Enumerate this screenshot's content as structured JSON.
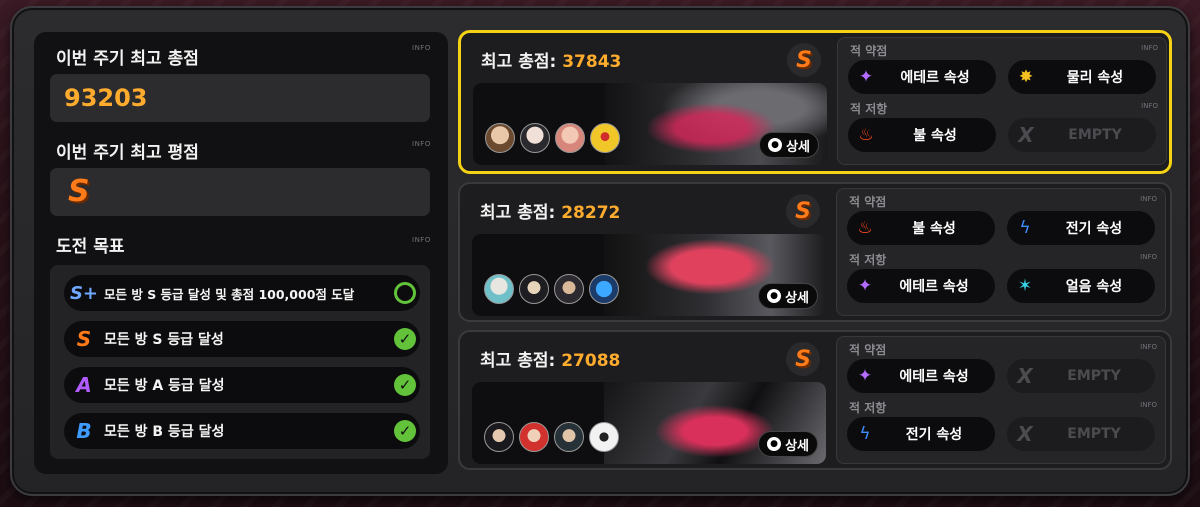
{
  "left_panel": {
    "cycle_best_score_title": "이번 주기 최고 총점",
    "cycle_best_score": "93203",
    "cycle_best_grade_title": "이번 주기 최고 평점",
    "cycle_best_grade": "S",
    "goals_title": "도전 목표",
    "info": "INFO",
    "goals": [
      {
        "badge": "S+",
        "text": "모든 방 S 등급 달성 및 총점 100,000점 도달",
        "done": false
      },
      {
        "badge": "S",
        "text": "모든 방 S 등급 달성",
        "done": true
      },
      {
        "badge": "A",
        "text": "모든 방 A 등급 달성",
        "done": true
      },
      {
        "badge": "B",
        "text": "모든 방 B 등급 달성",
        "done": true
      }
    ]
  },
  "labels": {
    "best_score": "최고 총점: ",
    "weak": "적 약점",
    "resist": "적 저항",
    "detail": "상세",
    "info": "INFO"
  },
  "rooms": [
    {
      "score": "37843",
      "rank": "S",
      "selected": true,
      "weak": [
        {
          "name": "에테르 속성",
          "icon": "ether-icon"
        },
        {
          "name": "물리 속성",
          "icon": "physical-icon"
        }
      ],
      "resist": [
        {
          "name": "불 속성",
          "icon": "fire-icon"
        },
        {
          "name": "EMPTY",
          "icon": "empty-icon"
        }
      ]
    },
    {
      "score": "28272",
      "rank": "S",
      "selected": false,
      "weak": [
        {
          "name": "불 속성",
          "icon": "fire-icon"
        },
        {
          "name": "전기 속성",
          "icon": "electric-icon"
        }
      ],
      "resist": [
        {
          "name": "에테르 속성",
          "icon": "ether-icon"
        },
        {
          "name": "얼음 속성",
          "icon": "ice-icon"
        }
      ]
    },
    {
      "score": "27088",
      "rank": "S",
      "selected": false,
      "weak": [
        {
          "name": "에테르 속성",
          "icon": "ether-icon"
        },
        {
          "name": "EMPTY",
          "icon": "empty-icon"
        }
      ],
      "resist": [
        {
          "name": "전기 속성",
          "icon": "electric-icon"
        },
        {
          "name": "EMPTY",
          "icon": "empty-icon"
        }
      ]
    }
  ],
  "colors": {
    "accent_score": "#ffac2e",
    "selected_border": "#f5d214",
    "check": "#62c23a",
    "grade_s": "#ff7a18"
  }
}
